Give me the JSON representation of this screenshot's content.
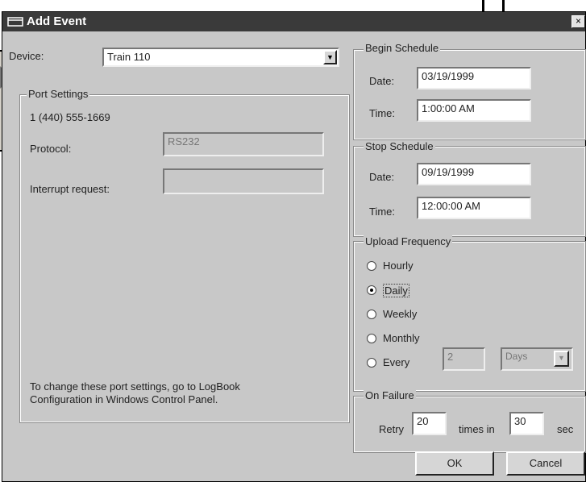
{
  "dialog": {
    "title": "Add Event",
    "close_label": "×"
  },
  "device": {
    "label": "Device:",
    "value": "Train 110"
  },
  "port_settings": {
    "legend": "Port Settings",
    "phone": "1 (440) 555-1669",
    "protocol_label": "Protocol:",
    "protocol_value": "RS232",
    "interrupt_label": "Interrupt request:",
    "interrupt_value": "",
    "note_line1": "To change these port settings, go to LogBook",
    "note_line2": "Configuration in Windows Control Panel."
  },
  "begin_schedule": {
    "legend": "Begin Schedule",
    "date_label": "Date:",
    "date_value": "03/19/1999",
    "time_label": "Time:",
    "time_value": "1:00:00 AM"
  },
  "stop_schedule": {
    "legend": "Stop Schedule",
    "date_label": "Date:",
    "date_value": "09/19/1999",
    "time_label": "Time:",
    "time_value": "12:00:00 AM"
  },
  "upload_frequency": {
    "legend": "Upload Frequency",
    "options": [
      {
        "label": "Hourly",
        "checked": false
      },
      {
        "label": "Daily",
        "checked": true
      },
      {
        "label": "Weekly",
        "checked": false
      },
      {
        "label": "Monthly",
        "checked": false
      },
      {
        "label": "Every",
        "checked": false
      }
    ],
    "every_value": "2",
    "every_unit": "Days"
  },
  "on_failure": {
    "legend": "On Failure",
    "retry_label": "Retry",
    "retry_value": "20",
    "times_label": "times in",
    "interval_value": "30",
    "unit_label": "sec"
  },
  "buttons": {
    "ok": "OK",
    "cancel": "Cancel"
  },
  "icons": {
    "dropdown": "chevron-down-icon",
    "window": "window-icon"
  }
}
